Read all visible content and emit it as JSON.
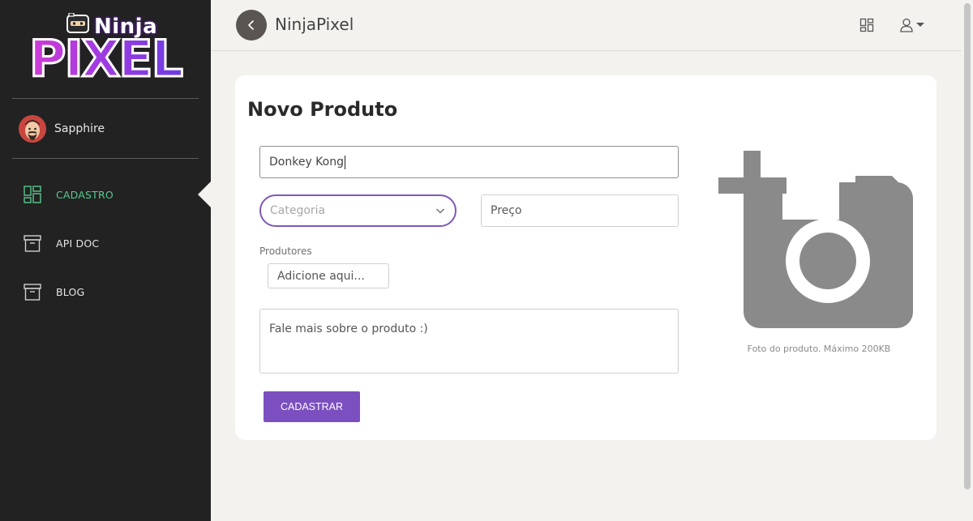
{
  "brand": {
    "logo_top": "Ninja",
    "logo_bottom": "PIXEL",
    "app_title": "NinjaPixel"
  },
  "user": {
    "name": "Sapphire"
  },
  "sidebar": {
    "items": [
      {
        "label": "CADASTRO",
        "icon": "dashboard-icon",
        "active": true
      },
      {
        "label": "API DOC",
        "icon": "archive-icon",
        "active": false
      },
      {
        "label": "BLOG",
        "icon": "archive-icon",
        "active": false
      }
    ],
    "active_color": "#58c98c"
  },
  "header": {
    "icons": [
      "back-arrow-icon",
      "grid-icon",
      "user-icon",
      "caret-down-icon"
    ]
  },
  "form": {
    "title": "Novo Produto",
    "name_value": "Donkey Kong",
    "category_placeholder": "Categoria",
    "price_placeholder": "Preço",
    "producers_label": "Produtores",
    "producers_placeholder": "Adicione aqui...",
    "description_placeholder": "Fale mais sobre o produto :)",
    "submit_label": "CADASTRAR",
    "photo_caption": "Foto do produto. Máximo 200KB"
  },
  "colors": {
    "sidebar_bg": "#222222",
    "accent_purple": "#7b4fc0",
    "page_bg": "#f3f2ef"
  }
}
